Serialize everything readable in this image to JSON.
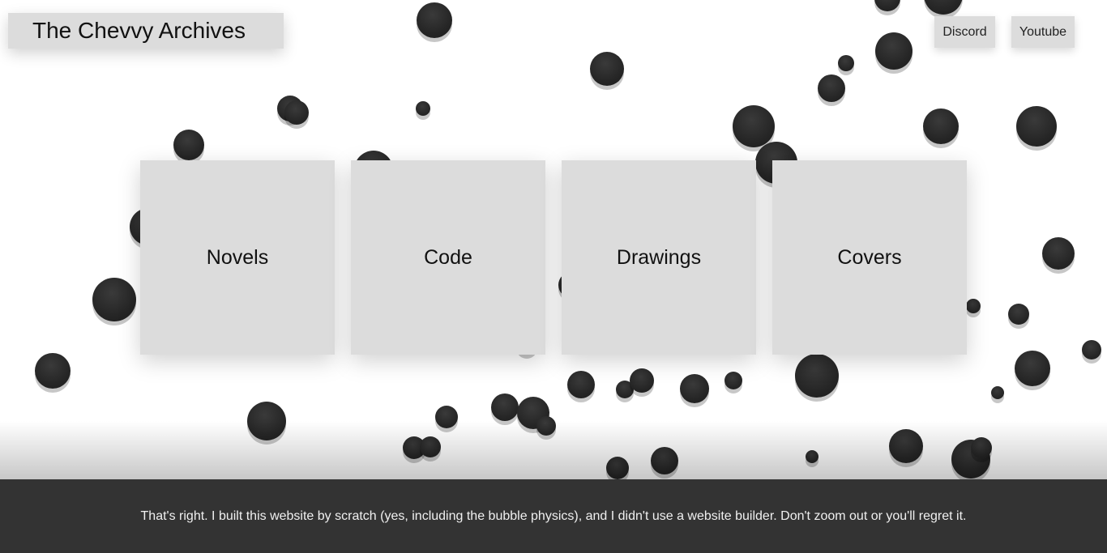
{
  "header": {
    "title": "The Chevvy Archives"
  },
  "nav": [
    {
      "label": "Discord"
    },
    {
      "label": "Youtube"
    }
  ],
  "cards": [
    {
      "label": "Novels"
    },
    {
      "label": "Code"
    },
    {
      "label": "Drawings"
    },
    {
      "label": "Covers"
    }
  ],
  "footer": {
    "text": "That's right. I built this website by scratch (yes, including the bubble physics), and I didn't use a website builder. Don't zoom out or you'll regret it."
  },
  "colors": {
    "card_bg": "#dcdcdc",
    "bubble": "#262626",
    "footer_bg": "#333333"
  }
}
